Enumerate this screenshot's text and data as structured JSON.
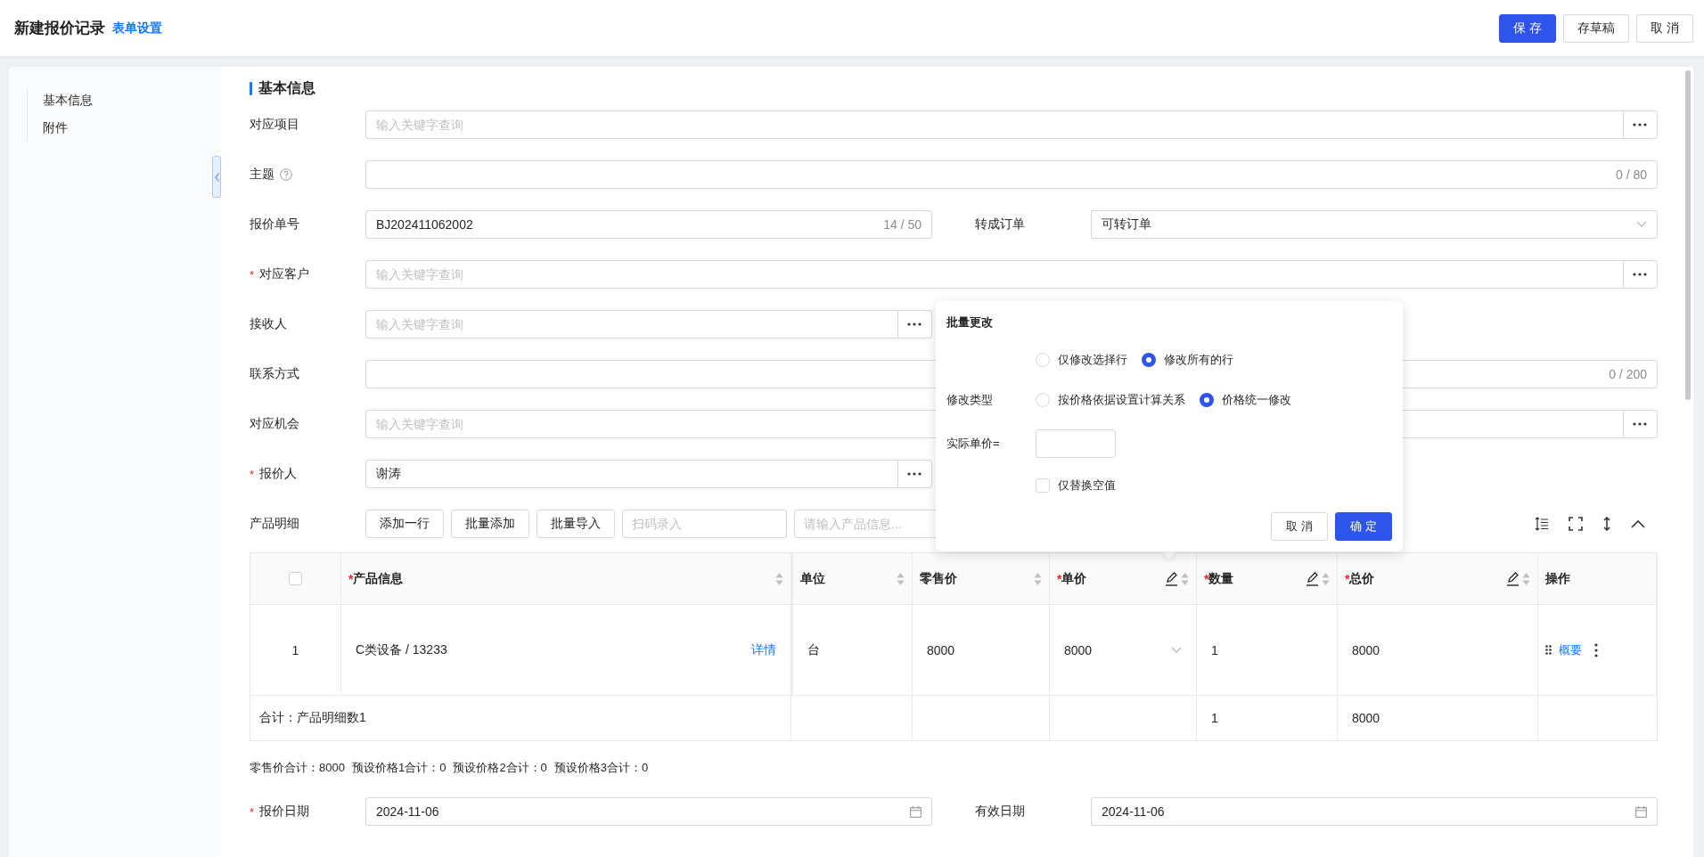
{
  "header": {
    "title": "新建报价记录",
    "link": "表单设置",
    "buttons": [
      {
        "label": "保 存",
        "kind": "primary"
      },
      {
        "label": "存草稿",
        "kind": "default"
      },
      {
        "label": "取 消",
        "kind": "default"
      }
    ]
  },
  "sidebar": {
    "items": [
      {
        "label": "基本信息"
      },
      {
        "label": "附件"
      }
    ]
  },
  "section_title": "基本信息",
  "form_rows": [
    {
      "fields": [
        {
          "label": "对应项目",
          "kind": "lookup",
          "placeholder": "输入关键字查询"
        }
      ]
    },
    {
      "fields": [
        {
          "label": "主题",
          "help": true,
          "kind": "counter",
          "counter": "0 / 80"
        }
      ]
    },
    {
      "fields": [
        {
          "label": "报价单号",
          "kind": "counter",
          "value": "BJ202411062002",
          "counter": "14 / 50"
        },
        {
          "label": "转成订单",
          "kind": "select",
          "value": "可转订单"
        }
      ]
    },
    {
      "fields": [
        {
          "mark": "*",
          "label": "对应客户",
          "kind": "lookup",
          "placeholder": "输入关键字查询"
        }
      ]
    },
    {
      "fields": [
        {
          "label": "接收人",
          "kind": "lookup",
          "placeholder": "输入关键字查询"
        }
      ]
    },
    {
      "fields": [
        {
          "label": "联系方式",
          "kind": "counter",
          "counter": "0 / 200"
        }
      ]
    },
    {
      "fields": [
        {
          "label": "对应机会",
          "kind": "lookup",
          "placeholder": "输入关键字查询"
        }
      ]
    },
    {
      "fields": [
        {
          "mark": "*",
          "label": "报价人",
          "kind": "lookup",
          "value": "谢涛"
        }
      ]
    }
  ],
  "product_toolbar": {
    "label": "产品明细",
    "buttons": [
      "添加一行",
      "批量添加",
      "批量导入"
    ],
    "inputs": [
      {
        "placeholder": "扫码录入"
      },
      {
        "placeholder": "请输入产品信息..."
      }
    ]
  },
  "table": {
    "columns": [
      {
        "kind": "checkbox",
        "checked": false
      },
      {
        "kind": "text",
        "mark": "*",
        "label": "产品信息",
        "sortable": true,
        "editable": false
      },
      {
        "kind": "text",
        "label": "单位",
        "sortable": true,
        "editable": false
      },
      {
        "kind": "text",
        "label": "零售价",
        "sortable": true,
        "editable": false
      },
      {
        "kind": "text",
        "mark": "*",
        "label": "单价",
        "sortable": true,
        "editable": true
      },
      {
        "kind": "text",
        "mark": "*",
        "label": "数量",
        "sortable": true,
        "editable": true
      },
      {
        "kind": "text",
        "mark": "*",
        "label": "总价",
        "sortable": true,
        "editable": true
      },
      {
        "kind": "text",
        "label": "操作",
        "sortable": false,
        "editable": false
      }
    ],
    "rows": [
      {
        "cells": [
          {
            "kind": "index",
            "text": "1"
          },
          {
            "kind": "product",
            "text": "C类设备 / 13233",
            "link": "详情"
          },
          {
            "kind": "text",
            "text": "台"
          },
          {
            "kind": "text",
            "text": "8000"
          },
          {
            "kind": "select",
            "text": "8000"
          },
          {
            "kind": "text",
            "text": "1"
          },
          {
            "kind": "text",
            "text": "8000"
          },
          {
            "kind": "actions",
            "link": "概要"
          }
        ]
      }
    ],
    "footer": {
      "label": "合计：产品明细数1",
      "quantity": "1",
      "total": "8000"
    }
  },
  "summary": [
    "零售价合计：8000",
    "预设价格1合计：0",
    "预设价格2合计：0",
    "预设价格3合计：0"
  ],
  "date_row": {
    "fields": [
      {
        "mark": "*",
        "label": "报价日期",
        "kind": "date",
        "value": "2024-11-06"
      },
      {
        "label": "有效日期",
        "kind": "date",
        "value": "2024-11-06"
      }
    ]
  },
  "popup": {
    "title": "批量更改",
    "scope_options": [
      {
        "label": "仅修改选择行",
        "selected": false
      },
      {
        "label": "修改所有的行",
        "selected": true
      }
    ],
    "type_label": "修改类型",
    "type_options": [
      {
        "label": "按价格依据设置计算关系",
        "selected": false
      },
      {
        "label": "价格统一修改",
        "selected": true
      }
    ],
    "price_label": "实际单价=",
    "empty_only": {
      "label": "仅替换空值",
      "checked": false
    },
    "buttons": [
      {
        "label": "取 消",
        "kind": "default"
      },
      {
        "label": "确 定",
        "kind": "primary"
      }
    ]
  }
}
